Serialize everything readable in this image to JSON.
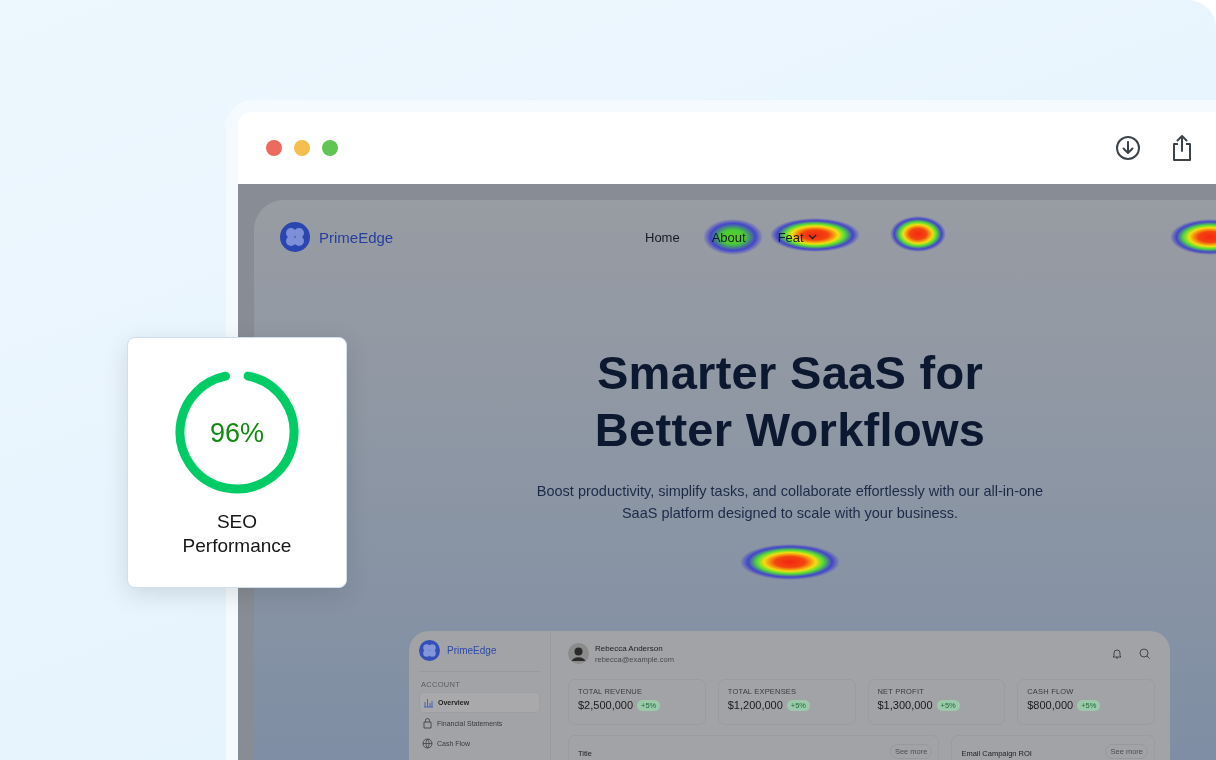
{
  "seo_card": {
    "value": "96%",
    "level": 0.96,
    "label": "SEO Performance"
  },
  "site": {
    "logo": "PrimeEdge",
    "nav": [
      {
        "label": "Home",
        "has_menu": false
      },
      {
        "label": "About",
        "has_menu": false
      },
      {
        "label": "Feat",
        "has_menu": true
      }
    ],
    "hero": {
      "title_lines": [
        "Smarter SaaS for",
        "Better Workflows"
      ],
      "subtitle_lines": [
        "Boost productivity, simplify tasks, and collaborate effortlessly with our all-in-one",
        "SaaS platform designed to scale with your business."
      ]
    },
    "dashboard": {
      "logo": "PrimeEdge",
      "section": "ACCOUNT",
      "menu": [
        {
          "label": "Overview",
          "selected": true,
          "kind": "chart"
        },
        {
          "label": "Financial Statements",
          "selected": false,
          "kind": "bag"
        },
        {
          "label": "Cash Flow",
          "selected": false,
          "kind": "globe"
        }
      ],
      "user": {
        "name": "Rebecca Anderson",
        "email": "rebecca@example.com"
      },
      "stats": [
        {
          "label": "TOTAL REVENUE",
          "value": "$2,500,000",
          "change": "+5%"
        },
        {
          "label": "TOTAL EXPENSES",
          "value": "$1,200,000",
          "change": "+5%"
        },
        {
          "label": "NET PROFIT",
          "value": "$1,300,000",
          "change": "+5%"
        },
        {
          "label": "CASH FLOW",
          "value": "$800,000",
          "change": "+5%"
        }
      ],
      "panels": [
        {
          "title": "Title",
          "action": "See more"
        },
        {
          "title": "Email Campaign ROI",
          "action": "See more"
        }
      ]
    }
  }
}
